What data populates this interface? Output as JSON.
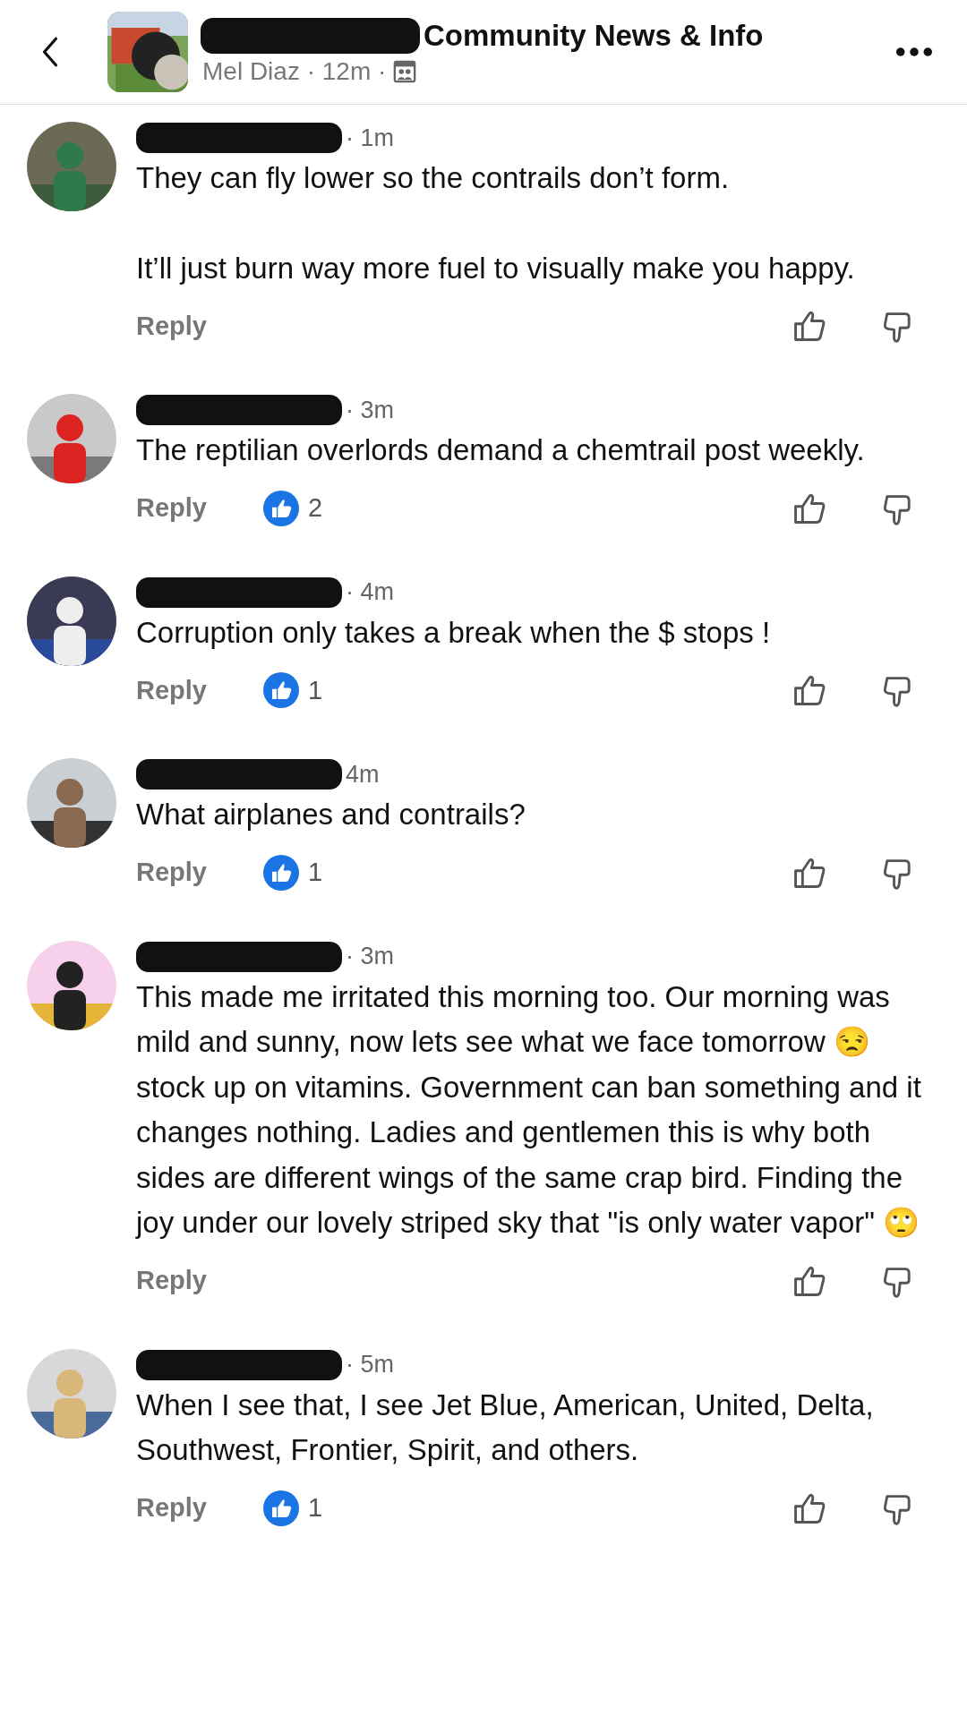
{
  "header": {
    "group_name": "Community News & Info",
    "meta": "Mel Diaz · 12m ·"
  },
  "comments": [
    {
      "time": "· 1m",
      "paragraphs": [
        "They can fly lower so the contrails don’t form.",
        "It’ll just burn way more fuel to visually make you happy."
      ],
      "reply": "Reply"
    },
    {
      "time": "· 3m",
      "paragraphs": [
        "The reptilian overlords demand a chemtrail post weekly."
      ],
      "reply": "Reply",
      "likes": "2"
    },
    {
      "time": "· 4m",
      "paragraphs": [
        "Corruption only takes a break when the $ stops !"
      ],
      "reply": "Reply",
      "likes": "1"
    },
    {
      "time": "4m",
      "paragraphs": [
        "What airplanes and contrails?"
      ],
      "reply": "Reply",
      "likes": "1"
    },
    {
      "time": "· 3m",
      "paragraphs": [
        "This made me irritated this morning too. Our morning was mild and sunny, now lets see what we face tomorrow 😒 stock up on vitamins. Government can ban something and it changes nothing. Ladies and gentlemen this is why both sides are different wings of the same crap bird. Finding the joy under our lovely striped sky that \"is only water vapor\" 🙄"
      ],
      "reply": "Reply"
    },
    {
      "time": "· 5m",
      "paragraphs": [
        "When I see that, I see Jet Blue, American, United, Delta, Southwest, Frontier, Spirit, and others."
      ],
      "reply": "Reply",
      "likes": "1"
    }
  ]
}
